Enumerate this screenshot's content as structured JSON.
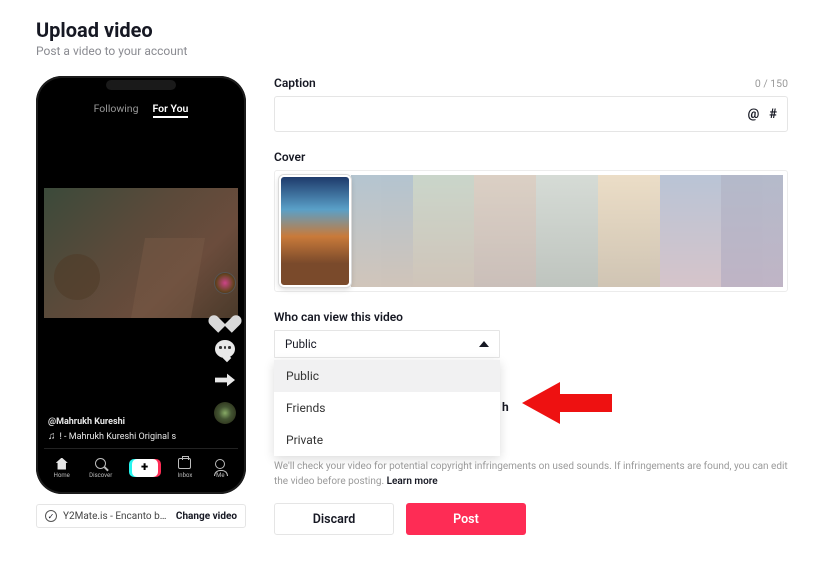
{
  "header": {
    "title": "Upload video",
    "subtitle": "Post a video to your account"
  },
  "phone": {
    "following": "Following",
    "for_you": "For You",
    "handle": "@Mahrukh Kureshi",
    "sound": "! - Mahrukh Kureshi Original s",
    "nav": {
      "home": "Home",
      "discover": "Discover",
      "inbox": "Inbox",
      "me": "Me"
    }
  },
  "file": {
    "name": "Y2Mate.is - Encanto bu...",
    "change": "Change video"
  },
  "caption": {
    "label": "Caption",
    "counter": "0 / 150",
    "at": "@",
    "hash": "#"
  },
  "cover": {
    "label": "Cover"
  },
  "visibility": {
    "label": "Who can view this video",
    "selected": "Public",
    "options": [
      "Public",
      "Friends",
      "Private"
    ],
    "hidden_peek": "h"
  },
  "copyright": {
    "text_a": "We'll check your video for potential copyright infringements on used sounds. If infringements are found, you can edit the video before posting. ",
    "learn_more": "Learn more"
  },
  "buttons": {
    "discard": "Discard",
    "post": "Post"
  }
}
